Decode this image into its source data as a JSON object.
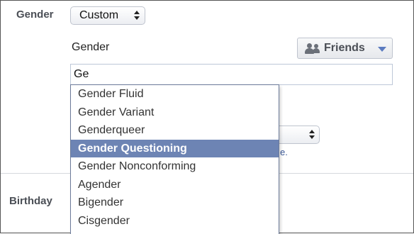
{
  "gender_row": {
    "label": "Gender",
    "select_value": "Custom"
  },
  "custom_gender": {
    "caption": "Gender",
    "audience_button": {
      "label": "Friends",
      "icon": "people-icon"
    },
    "input_value": "Ge"
  },
  "suggestions": [
    {
      "label": "Gender Fluid",
      "selected": false
    },
    {
      "label": "Gender Variant",
      "selected": false
    },
    {
      "label": "Genderqueer",
      "selected": false
    },
    {
      "label": "Gender Questioning",
      "selected": true
    },
    {
      "label": "Gender Nonconforming",
      "selected": false
    },
    {
      "label": "Agender",
      "selected": false
    },
    {
      "label": "Bigender",
      "selected": false
    },
    {
      "label": "Cisgender",
      "selected": false
    }
  ],
  "partial_link": "e.",
  "birthday_row": {
    "label": "Birthday"
  },
  "colors": {
    "selected_item_bg": "#6d84b4",
    "link": "#3b5998",
    "caret": "#5b7bc0"
  }
}
